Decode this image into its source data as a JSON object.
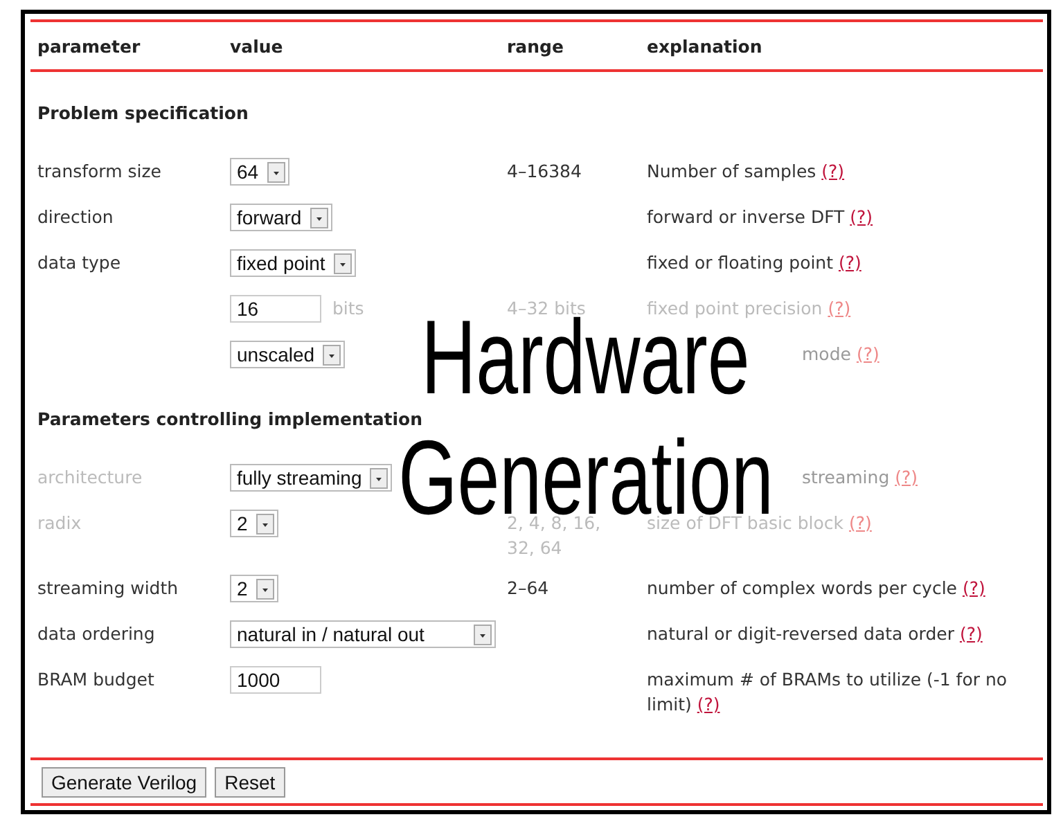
{
  "columns": [
    "parameter",
    "value",
    "range",
    "explanation"
  ],
  "sections": [
    {
      "title": "Problem specification",
      "rows": [
        {
          "parameter": "transform size",
          "control": {
            "kind": "select",
            "value": "64"
          },
          "range": "4–16384",
          "explanation": "Number of samples",
          "help": "(?)",
          "faded": false
        },
        {
          "parameter": "direction",
          "control": {
            "kind": "select",
            "value": "forward"
          },
          "explanation": "forward or inverse DFT",
          "help": "(?)",
          "faded": false
        },
        {
          "parameter": "data type",
          "control": {
            "kind": "select",
            "value": "fixed point"
          },
          "explanation": "fixed or floating point",
          "help": "(?)",
          "faded": false
        },
        {
          "control": {
            "kind": "input",
            "value": "16",
            "unit": "bits"
          },
          "range": "4–32 bits",
          "explanation": "fixed point precision",
          "help": "(?)",
          "faded": true
        },
        {
          "control": {
            "kind": "select",
            "value": "unscaled"
          },
          "explanation": "mode",
          "help": "(?)",
          "faded": true,
          "covered": true
        }
      ]
    },
    {
      "title": "Parameters controlling implementation",
      "rows": [
        {
          "parameter": "architecture",
          "control": {
            "kind": "select",
            "value": "fully streaming"
          },
          "explanation": "streaming",
          "help": "(?)",
          "faded": true,
          "covered": true
        },
        {
          "parameter": "radix",
          "control": {
            "kind": "select",
            "value": "2"
          },
          "range": "2, 4, 8, 16, 32, 64",
          "explanation": "size of DFT basic block",
          "help": "(?)",
          "faded": true
        },
        {
          "parameter": "streaming width",
          "control": {
            "kind": "select",
            "value": "2"
          },
          "range": "2–64",
          "explanation": "number of complex words per cycle",
          "help": "(?)",
          "faded": false
        },
        {
          "parameter": "data ordering",
          "control": {
            "kind": "select",
            "value": "natural in / natural out",
            "wide": true
          },
          "explanation": "natural or digit-reversed data order",
          "help": "(?)",
          "faded": false
        },
        {
          "parameter": "BRAM budget",
          "control": {
            "kind": "input",
            "value": "1000"
          },
          "explanation": "maximum # of BRAMs to utilize (-1 for no limit)",
          "help": "(?)",
          "faded": false
        }
      ]
    }
  ],
  "buttons": [
    "Generate Verilog",
    "Reset"
  ],
  "overlay_title": [
    "Hardware",
    "Generation"
  ]
}
